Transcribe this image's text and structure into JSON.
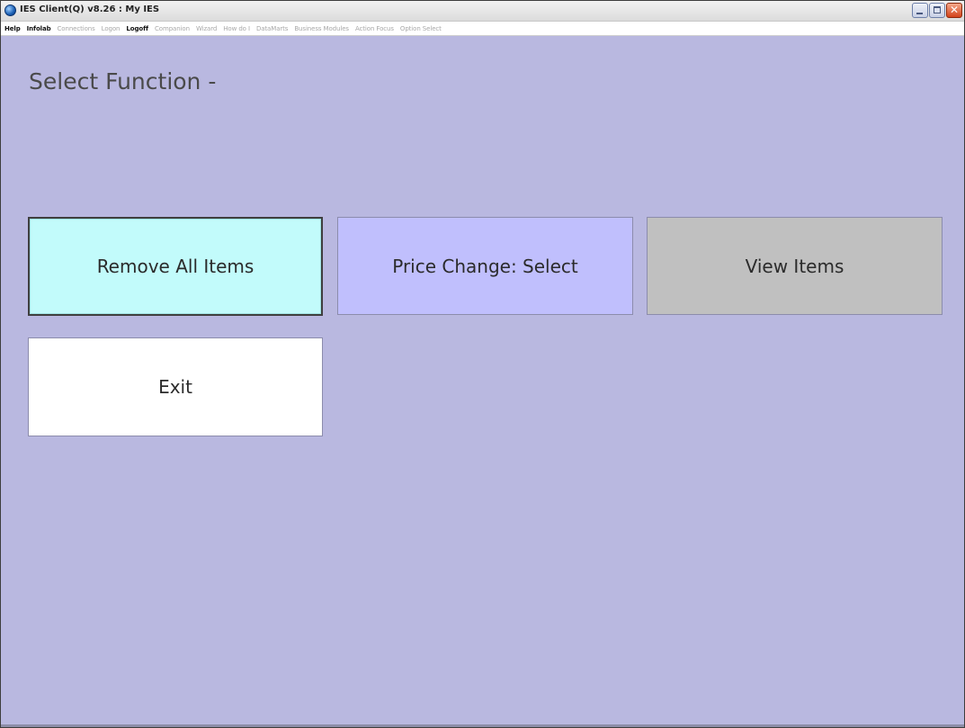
{
  "window": {
    "title": "IES Client(Q) v8.26 : My IES",
    "minimize_label": "",
    "maximize_label": "",
    "close_label": "✕"
  },
  "menu": {
    "items": [
      {
        "label": "Help",
        "enabled": true
      },
      {
        "label": "Infolab",
        "enabled": true
      },
      {
        "label": "Connections",
        "enabled": false
      },
      {
        "label": "Logon",
        "enabled": false
      },
      {
        "label": "Logoff",
        "enabled": true
      },
      {
        "label": "Companion",
        "enabled": false
      },
      {
        "label": "Wizard",
        "enabled": false
      },
      {
        "label": "How do I",
        "enabled": false
      },
      {
        "label": "DataMarts",
        "enabled": false
      },
      {
        "label": "Business Modules",
        "enabled": false
      },
      {
        "label": "Action Focus",
        "enabled": false
      },
      {
        "label": "Option Select",
        "enabled": false
      }
    ]
  },
  "page": {
    "title": "Select Function -"
  },
  "functions": [
    {
      "label": "Remove All Items",
      "color": "#c2fbfb",
      "selected": true
    },
    {
      "label": "Price Change: Select",
      "color": "#c0bffd",
      "selected": false
    },
    {
      "label": "View Items",
      "color": "#c0c0c0",
      "selected": false
    },
    {
      "label": "Exit",
      "color": "#ffffff",
      "selected": false
    }
  ],
  "colors": {
    "background": "#b9b8e0"
  }
}
